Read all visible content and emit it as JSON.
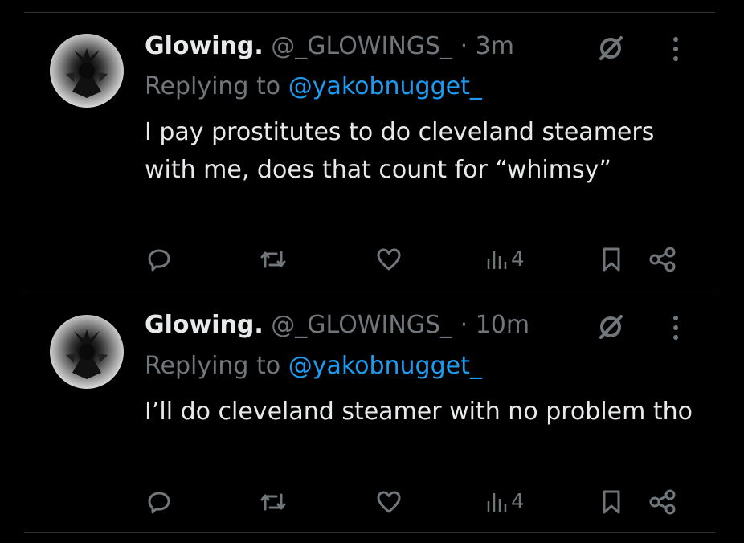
{
  "tweets": [
    {
      "display_name": "Glowing.",
      "handle": "@_GLOWINGS_",
      "time": "· 3m",
      "replying_prefix": "Replying to",
      "replying_to": "@yakobnugget_",
      "text": "I pay prostitutes to do cleveland steamers with me, does that count for “whimsy”",
      "views": "4"
    },
    {
      "display_name": "Glowing.",
      "handle": "@_GLOWINGS_",
      "time": "· 10m",
      "replying_prefix": "Replying to",
      "replying_to": "@yakobnugget_",
      "text": "I’ll do cleveland steamer with no problem tho",
      "views": "4"
    }
  ],
  "icons": {
    "grok": "grok-slash-icon",
    "more": "more-vertical-icon",
    "reply": "reply-icon",
    "retweet": "retweet-icon",
    "like": "like-icon",
    "views": "views-icon",
    "bookmark": "bookmark-icon",
    "share": "share-icon"
  },
  "colors": {
    "background": "#000000",
    "text": "#e7e9ea",
    "muted": "#71767b",
    "link": "#1d9bf0",
    "divider": "#2f3336"
  }
}
